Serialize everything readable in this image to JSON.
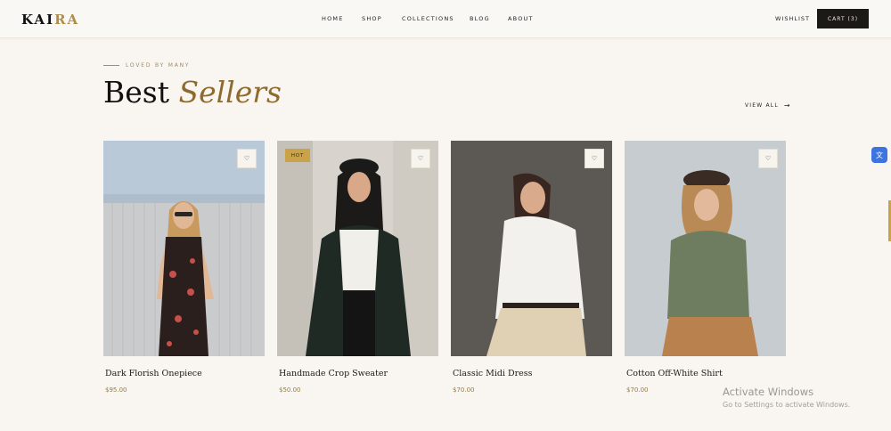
{
  "brand": {
    "logo_dark": "KAI",
    "logo_gold": "RA"
  },
  "nav": {
    "items": [
      {
        "label": "HOME"
      },
      {
        "label": "SHOP"
      },
      {
        "label": "COLLECTIONS"
      },
      {
        "label": "BLOG"
      },
      {
        "label": "ABOUT"
      }
    ],
    "wishlist_label": "WISHLIST",
    "cart_label": "CART (3)"
  },
  "section": {
    "eyebrow": "LOVED BY MANY",
    "title_plain": "Best",
    "title_accent": "Sellers",
    "view_all_label": "VIEW ALL",
    "view_all_icon": "→"
  },
  "products": [
    {
      "name": "Dark Florish Onepiece",
      "price": "$95.00",
      "badge": "",
      "heart_icon": "♡"
    },
    {
      "name": "Handmade Crop Sweater",
      "price": "$50.00",
      "badge": "HOT",
      "heart_icon": "♡"
    },
    {
      "name": "Classic Midi Dress",
      "price": "$70.00",
      "badge": "",
      "heart_icon": "♡"
    },
    {
      "name": "Cotton Off-White Shirt",
      "price": "$70.00",
      "badge": "",
      "heart_icon": "♡"
    }
  ],
  "overlay": {
    "activate_title": "Activate Windows",
    "activate_sub": "Go to Settings to activate Windows.",
    "translate_icon": "文"
  },
  "colors": {
    "background": "#f9f6f1",
    "accent_gold": "#b08d4a",
    "title_accent": "#8e6a2e",
    "cart_bg": "#1c1a17",
    "badge_bg": "#c9a24a"
  }
}
